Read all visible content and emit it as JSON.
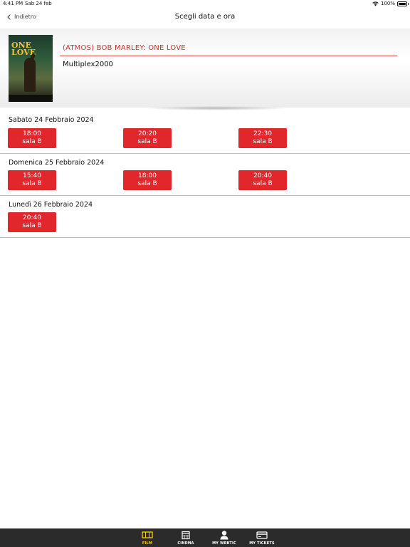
{
  "status_bar": {
    "time": "4:41 PM",
    "date": "Sab 24 feb",
    "battery": "100%"
  },
  "nav": {
    "back_label": "Indietro",
    "title": "Scegli data e ora"
  },
  "movie": {
    "title": "(ATMOS) BOB MARLEY: ONE LOVE",
    "cinema": "Multiplex2000",
    "poster_text": "ONE LOVE"
  },
  "days": [
    {
      "label": "Sabato 24 Febbraio 2024",
      "showtimes": [
        {
          "time": "18:00",
          "room": "sala B"
        },
        {
          "time": "20:20",
          "room": "sala B"
        },
        {
          "time": "22:30",
          "room": "sala B"
        }
      ]
    },
    {
      "label": "Domenica 25 Febbraio 2024",
      "showtimes": [
        {
          "time": "15:40",
          "room": "sala B"
        },
        {
          "time": "18:00",
          "room": "sala B"
        },
        {
          "time": "20:40",
          "room": "sala B"
        }
      ]
    },
    {
      "label": "Lunedì 26 Febbraio 2024",
      "showtimes": [
        {
          "time": "20:40",
          "room": "sala B"
        }
      ]
    }
  ],
  "tabs": [
    {
      "label": "FILM",
      "icon": "film-icon",
      "active": true
    },
    {
      "label": "CINEMA",
      "icon": "calendar-icon",
      "active": false
    },
    {
      "label": "MY WEBTIC",
      "icon": "user-icon",
      "active": false
    },
    {
      "label": "MY TICKETS",
      "icon": "ticket-icon",
      "active": false
    }
  ],
  "colors": {
    "accent": "#e1262c",
    "tab_bar": "#2b2b2b",
    "active_tab": "#f5d20a"
  }
}
